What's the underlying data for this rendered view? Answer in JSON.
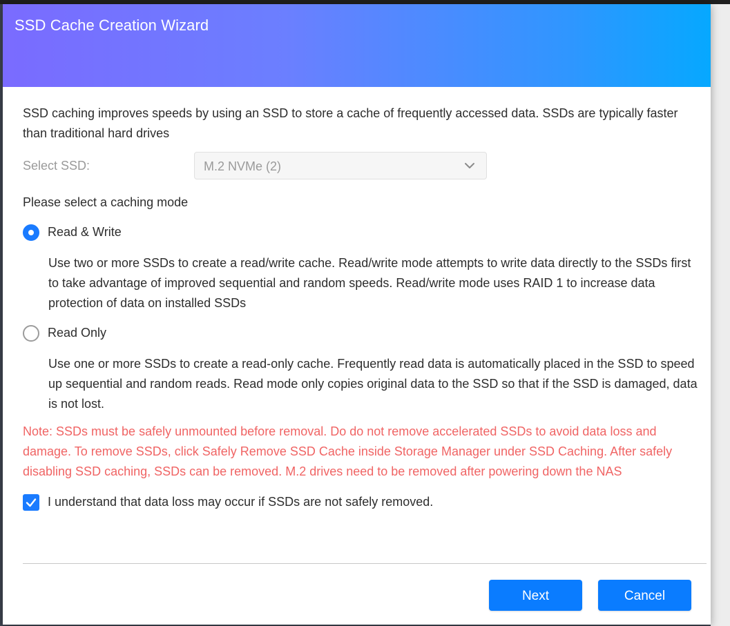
{
  "dialog": {
    "title": "SSD Cache Creation Wizard",
    "intro": "SSD caching improves speeds by using an SSD to store a cache of frequently accessed data. SSDs are typically faster than traditional hard drives",
    "select_ssd": {
      "label": "Select SSD:",
      "value": "M.2 NVMe (2)",
      "disabled": true
    },
    "mode_heading": "Please select a caching mode",
    "modes": [
      {
        "label": "Read & Write",
        "selected": true,
        "description": "Use two or more SSDs to create a read/write cache. Read/write mode attempts to write data directly to the SSDs first to take advantage of improved sequential and random speeds. Read/write mode uses RAID 1 to increase data protection of data on installed SSDs"
      },
      {
        "label": "Read Only",
        "selected": false,
        "description": "Use one or more SSDs to create a read-only cache. Frequently read data is automatically placed in the SSD to speed up sequential and random reads. Read mode only copies original data to the SSD so that if the SSD is damaged, data is not lost."
      }
    ],
    "note": "Note: SSDs must be safely unmounted before removal. Do do not remove accelerated SSDs to avoid data loss and damage. To remove SSDs, click Safely Remove SSD Cache inside Storage Manager under SSD Caching. After safely disabling SSD caching, SSDs can be removed. M.2 drives need to be removed after powering down the NAS",
    "acknowledge": {
      "label": "I understand that data loss may occur if SSDs are not safely removed.",
      "checked": true
    },
    "buttons": {
      "next": "Next",
      "cancel": "Cancel"
    }
  },
  "colors": {
    "accent": "#0a7cff",
    "note_text": "#f06464",
    "header_gradient_start": "#7a6bff",
    "header_gradient_end": "#06a8ff"
  },
  "icons": {
    "select_chevron": "chevron-down-icon",
    "checkbox_mark": "checkmark-icon"
  }
}
